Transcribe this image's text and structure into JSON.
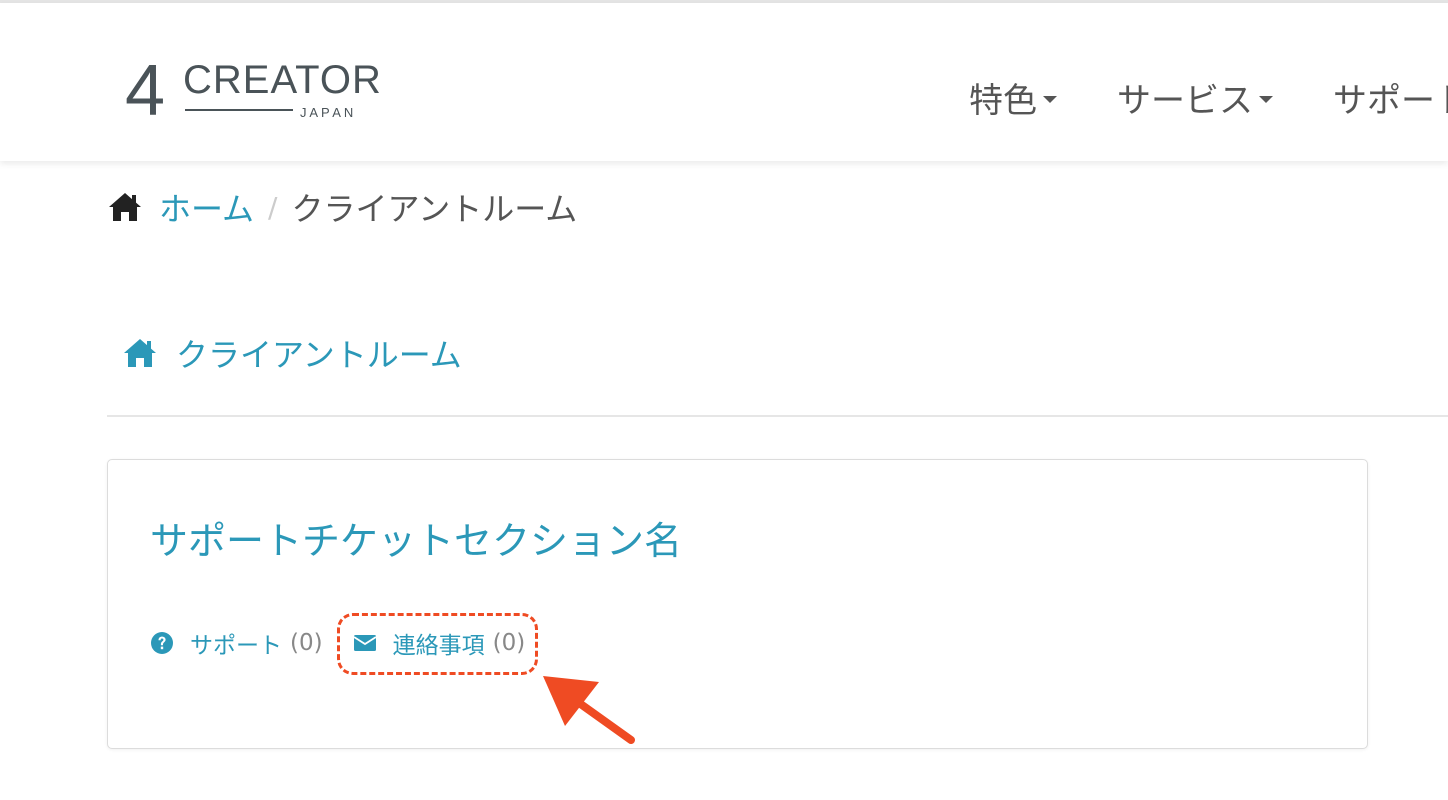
{
  "header": {
    "logo_main": "CREATOR",
    "logo_digit": "4",
    "logo_sub": "J A P A N",
    "nav": [
      {
        "label": "特色"
      },
      {
        "label": "サービス"
      },
      {
        "label": "サポート"
      }
    ]
  },
  "breadcrumb": {
    "home_label": "ホーム",
    "separator": "/",
    "current": "クライアントルーム"
  },
  "section": {
    "title": "クライアントルーム"
  },
  "panel": {
    "title": "サポートチケットセクション名",
    "links": [
      {
        "label": "サポート",
        "count": "(0)",
        "icon": "question-circle-icon"
      },
      {
        "label": "連絡事項",
        "count": "(0)",
        "icon": "envelope-icon"
      }
    ]
  },
  "colors": {
    "link": "#2b98b8",
    "text": "#555555",
    "count": "#888888",
    "annotation": "#ef4b23"
  }
}
